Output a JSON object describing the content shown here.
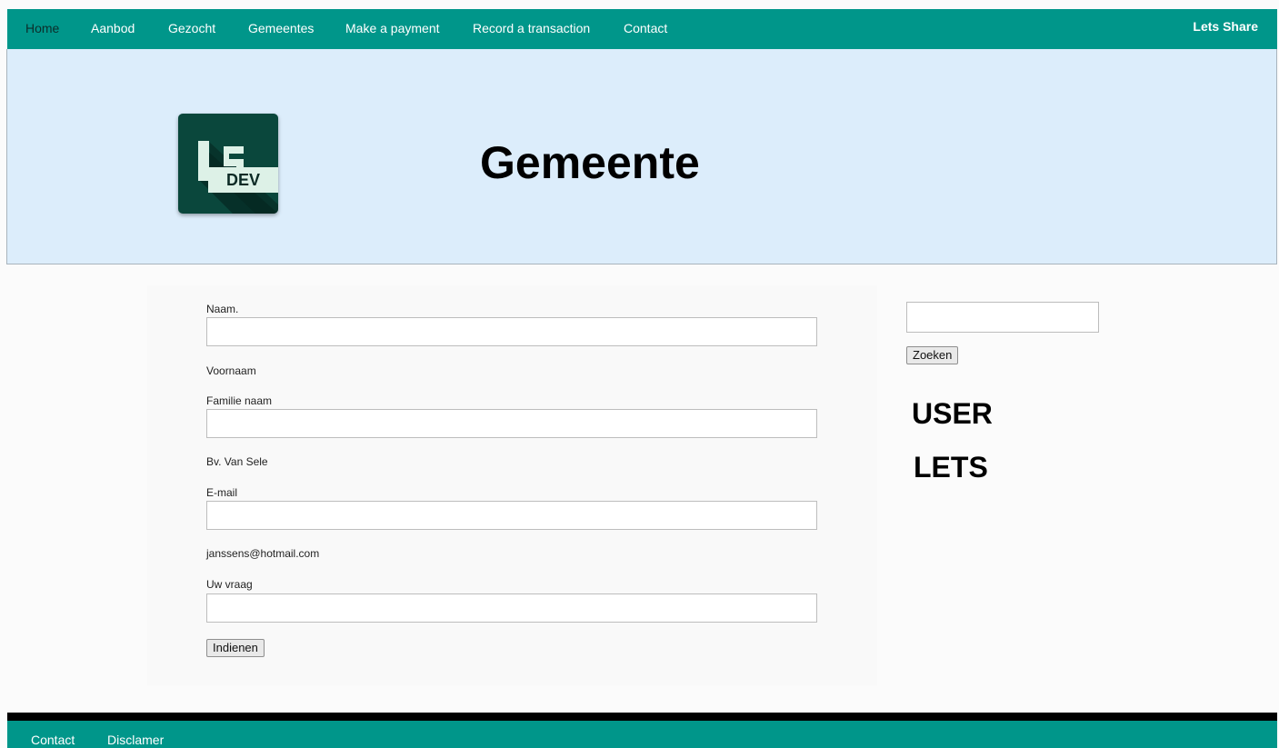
{
  "nav": {
    "items": [
      {
        "label": "Home",
        "active": true
      },
      {
        "label": "Aanbod"
      },
      {
        "label": "Gezocht"
      },
      {
        "label": "Gemeentes"
      },
      {
        "label": "Make a payment"
      },
      {
        "label": "Record a transaction"
      },
      {
        "label": "Contact"
      }
    ],
    "brand": "Lets Share"
  },
  "hero": {
    "logo_text": "DEV",
    "title": "Gemeente"
  },
  "form": {
    "name_label": "Naam.",
    "name_value": "",
    "first_name_hint": "Voornaam",
    "family_label": "Familie naam",
    "family_value": "",
    "family_hint": "Bv. Van Sele",
    "email_label": "E-mail",
    "email_value": "",
    "email_hint": "janssens@hotmail.com",
    "question_label": "Uw vraag",
    "question_value": "",
    "submit_label": "Indienen"
  },
  "sidebar": {
    "search_value": "",
    "search_button": "Zoeken",
    "heading_user": "USER",
    "heading_lets": "LETS"
  },
  "footer": {
    "links": [
      {
        "label": "Contact"
      },
      {
        "label": "Disclamer"
      }
    ]
  },
  "colors": {
    "nav_bg": "#00968a",
    "hero_bg": "#dcedfb",
    "logo_bg": "#0a473c",
    "footer_top": "#000000"
  }
}
